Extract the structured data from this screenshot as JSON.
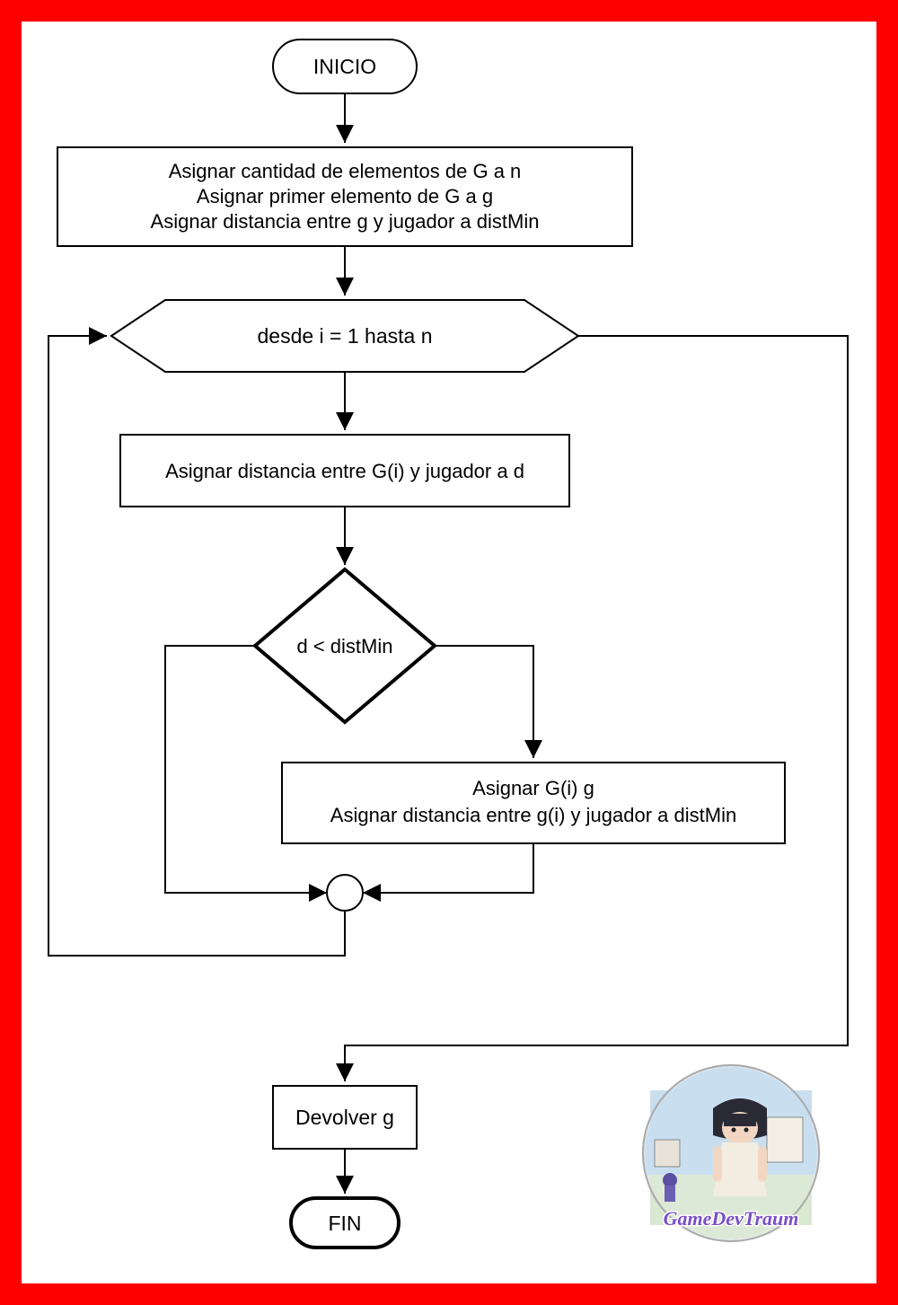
{
  "flowchart": {
    "start": "INICIO",
    "init": {
      "line1": "Asignar cantidad de elementos de G a n",
      "line2": "Asignar primer elemento de G a g",
      "line3": "Asignar distancia entre g y jugador a distMin"
    },
    "loop": "desde i = 1 hasta n",
    "assign_d": "Asignar distancia entre G(i) y jugador a d",
    "decision": "d < distMin",
    "update": {
      "line1": "Asignar G(i) g",
      "line2": "Asignar distancia entre g(i) y jugador a distMin"
    },
    "return": "Devolver g",
    "end": "FIN"
  },
  "logo": {
    "text": "GameDevTraum"
  }
}
